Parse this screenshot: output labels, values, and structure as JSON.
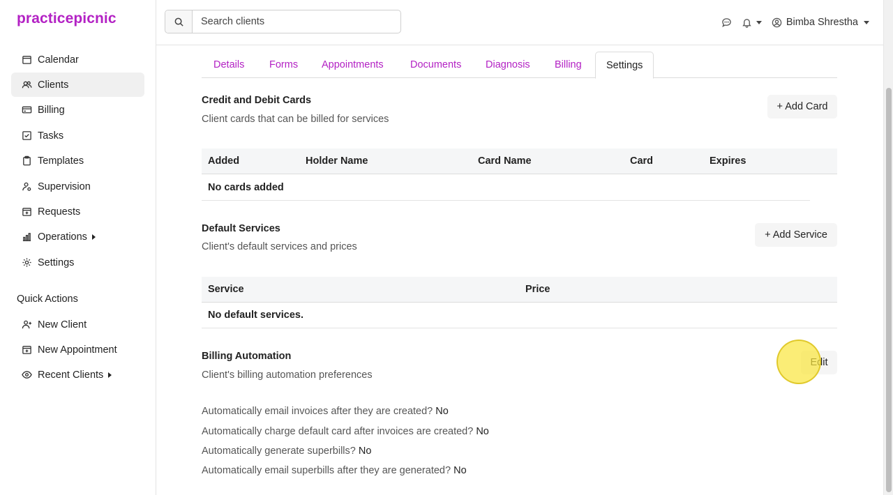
{
  "app": {
    "logo_text": "practicepicnic",
    "brand_color": "#b321c4"
  },
  "sidebar": {
    "items": [
      {
        "label": "Calendar",
        "icon": "calendar-icon"
      },
      {
        "label": "Clients",
        "icon": "users-icon",
        "active": true
      },
      {
        "label": "Billing",
        "icon": "credit-card-icon"
      },
      {
        "label": "Tasks",
        "icon": "checkbox-icon"
      },
      {
        "label": "Templates",
        "icon": "clipboard-icon"
      },
      {
        "label": "Supervision",
        "icon": "user-supervision-icon"
      },
      {
        "label": "Requests",
        "icon": "calendar-plus-icon"
      },
      {
        "label": "Operations",
        "icon": "bar-chart-icon",
        "has_submenu": true
      },
      {
        "label": "Settings",
        "icon": "gear-icon"
      }
    ],
    "quick_actions_label": "Quick Actions",
    "quick_actions": [
      {
        "label": "New Client",
        "icon": "user-plus-icon"
      },
      {
        "label": "New Appointment",
        "icon": "calendar-plus-icon"
      },
      {
        "label": "Recent Clients",
        "icon": "eye-icon",
        "has_submenu": true
      }
    ]
  },
  "header": {
    "search_placeholder": "Search clients",
    "user_name": "Bimba Shrestha"
  },
  "tabs": [
    "Details",
    "Forms",
    "Appointments",
    "Documents",
    "Diagnosis",
    "Billing",
    "Settings"
  ],
  "active_tab": "Settings",
  "cards": {
    "title": "Credit and Debit Cards",
    "subtitle": "Client cards that can be billed for services",
    "add_button": "+ Add Card",
    "columns": [
      "Added",
      "Holder Name",
      "Card Name",
      "Card",
      "Expires"
    ],
    "empty_text": "No cards added"
  },
  "services": {
    "title": "Default Services",
    "subtitle": "Client's default services and prices",
    "add_button": "+ Add Service",
    "columns": [
      "Service",
      "Price"
    ],
    "empty_text": "No default services."
  },
  "automation": {
    "title": "Billing Automation",
    "subtitle": "Client's billing automation preferences",
    "edit_button": "Edit",
    "settings": [
      {
        "question": "Automatically email invoices after they are created?",
        "value": "No"
      },
      {
        "question": "Automatically charge default card after invoices are created?",
        "value": "No"
      },
      {
        "question": "Automatically generate superbills?",
        "value": "No"
      },
      {
        "question": "Automatically email superbills after they are generated?",
        "value": "No"
      }
    ]
  }
}
